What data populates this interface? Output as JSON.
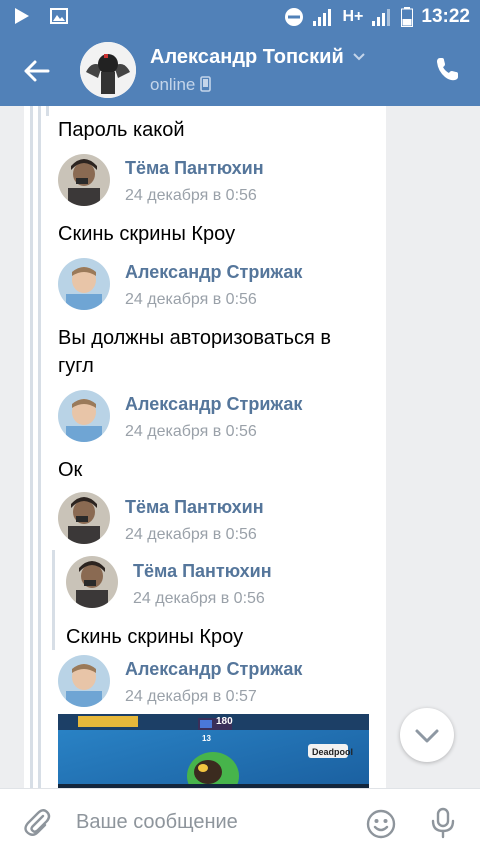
{
  "status_bar": {
    "time": "13:22",
    "icons": [
      "play-icon",
      "image-icon",
      "dnd-icon",
      "signal-icon",
      "network-type-icon",
      "signal-icon",
      "battery-icon"
    ],
    "network_label": "H+"
  },
  "header": {
    "name": "Александр Топский",
    "status": "online",
    "icons": [
      "back-arrow-icon",
      "chevron-down-icon",
      "phone-icon",
      "call-icon"
    ]
  },
  "messages": [
    {
      "type": "text",
      "text": "Пароль какой"
    },
    {
      "type": "forward",
      "name": "Тёма Пантюхин",
      "date": "24 декабря в 0:56"
    },
    {
      "type": "text",
      "text": "Скинь скрины Кроу"
    },
    {
      "type": "forward",
      "name": "Александр Стрижак",
      "date": "24 декабря в 0:56"
    },
    {
      "type": "text",
      "lines": [
        "Вы должны авторизоваться в",
        "гугл"
      ]
    },
    {
      "type": "forward",
      "name": "Александр Стрижак",
      "date": "24 декабря в 0:56"
    },
    {
      "type": "text",
      "text": "Ок"
    },
    {
      "type": "forward",
      "name": "Тёма Пантюхин",
      "date": "24 декабря в 0:56"
    },
    {
      "type": "forward",
      "name": "Тёма Пантюхин",
      "date": "24 декабря в 0:56"
    },
    {
      "type": "text",
      "text": "Скинь скрины Кроу"
    },
    {
      "type": "forward",
      "name": "Александр Стрижак",
      "date": "24 декабря в 0:57"
    },
    {
      "type": "photo",
      "labels": [
        "180",
        "Deadpool",
        "13"
      ]
    }
  ],
  "composer": {
    "placeholder": "Ваше сообщение",
    "icons": [
      "attach-icon",
      "emoji-icon",
      "microphone-icon"
    ]
  },
  "scroll_down": {
    "icon": "chevron-down-icon"
  },
  "colors": {
    "brand": "#5181b8",
    "name_link": "#55769b",
    "muted": "#9aa1a9"
  }
}
